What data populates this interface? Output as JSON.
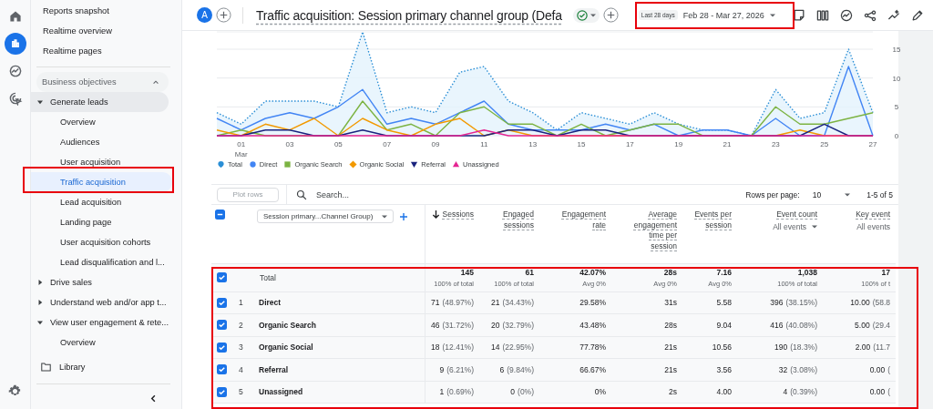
{
  "rail": {
    "items": [
      {
        "kind": "home",
        "selected": false
      },
      {
        "kind": "reports",
        "selected": true
      },
      {
        "kind": "explore",
        "selected": false
      },
      {
        "kind": "advertising",
        "selected": false
      }
    ]
  },
  "sidebar": {
    "items": [
      {
        "label": "Reports snapshot",
        "selected": false
      },
      {
        "label": "Realtime overview",
        "selected": false
      },
      {
        "label": "Realtime pages",
        "selected": false
      }
    ],
    "sections": [
      {
        "label": "Business objectives",
        "expanded": true,
        "children": [
          {
            "label": "Generate leads",
            "expanded": true,
            "children": [
              {
                "label": "Overview",
                "selected": false
              },
              {
                "label": "Audiences",
                "selected": false
              },
              {
                "label": "User acquisition",
                "selected": false
              },
              {
                "label": "Traffic acquisition",
                "selected": true
              },
              {
                "label": "Lead acquisition",
                "selected": false
              },
              {
                "label": "Landing page",
                "selected": false
              },
              {
                "label": "User acquisition cohorts",
                "selected": false
              },
              {
                "label": "Lead disqualification and l...",
                "selected": false
              }
            ]
          },
          {
            "label": "Drive sales",
            "expanded": false
          },
          {
            "label": "Understand web and/or app t...",
            "expanded": false
          },
          {
            "label": "View user engagement & rete...",
            "expanded": true,
            "children": [
              {
                "label": "Overview",
                "selected": false
              }
            ]
          }
        ]
      }
    ],
    "library": "Library"
  },
  "header": {
    "avatar": "A",
    "title": "Traffic acquisition: Session primary channel group (Defa",
    "date_chip": "Last 28 days",
    "date_range": "Feb 28 - Mar 27, 2026",
    "actions": [
      {
        "kind": "note"
      },
      {
        "kind": "compare"
      },
      {
        "kind": "insights"
      },
      {
        "kind": "share"
      },
      {
        "kind": "trend"
      },
      {
        "kind": "edit"
      }
    ]
  },
  "chart": {
    "chart_data": {
      "type": "line",
      "grid": true,
      "legend": "bottom",
      "xlim": [
        0,
        27
      ],
      "ylim": [
        0,
        18
      ],
      "x": [
        0,
        1,
        2,
        3,
        4,
        5,
        6,
        7,
        8,
        9,
        10,
        11,
        12,
        13,
        14,
        15,
        16,
        17,
        18,
        19,
        20,
        21,
        22,
        23,
        24,
        25,
        26,
        27
      ],
      "xticks": [
        {
          "value": 1,
          "label": "01"
        },
        {
          "value": 3,
          "label": "03"
        },
        {
          "value": 5,
          "label": "05"
        },
        {
          "value": 7,
          "label": "07"
        },
        {
          "value": 9,
          "label": "09"
        },
        {
          "value": 11,
          "label": "11"
        },
        {
          "value": 13,
          "label": "13"
        },
        {
          "value": 15,
          "label": "15"
        },
        {
          "value": 17,
          "label": "17"
        },
        {
          "value": 19,
          "label": "19"
        },
        {
          "value": 21,
          "label": "21"
        },
        {
          "value": 23,
          "label": "23"
        },
        {
          "value": 25,
          "label": "25"
        },
        {
          "value": 27,
          "label": "27"
        }
      ],
      "yticks": [
        0,
        5,
        10,
        15
      ],
      "annotations": [
        "Mar"
      ],
      "series": [
        {
          "name": "Total",
          "color": "#2b8fd6",
          "line_style": "dotted",
          "values": [
            4,
            2,
            6,
            6,
            6,
            5,
            18,
            4,
            5,
            4,
            11,
            12,
            6,
            4,
            1,
            4,
            3,
            2,
            4,
            2,
            1,
            1,
            0,
            8,
            3,
            4,
            15,
            4
          ]
        },
        {
          "name": "Direct",
          "color": "#4285f4",
          "line_style": "solid",
          "values": [
            3,
            1,
            3,
            4,
            3,
            5,
            8,
            2,
            3,
            2,
            4,
            6,
            2,
            1,
            1,
            1,
            2,
            1,
            2,
            0,
            1,
            1,
            0,
            3,
            0,
            0,
            12,
            0
          ]
        },
        {
          "name": "Organic Search",
          "color": "#7cb342",
          "line_style": "solid",
          "values": [
            0,
            1,
            0,
            0,
            0,
            0,
            6,
            1,
            2,
            0,
            4,
            5,
            2,
            2,
            0,
            2,
            0,
            1,
            2,
            2,
            0,
            0,
            0,
            5,
            2,
            2,
            3,
            4
          ]
        },
        {
          "name": "Organic Social",
          "color": "#f29900",
          "line_style": "solid",
          "values": [
            1,
            0,
            2,
            1,
            3,
            0,
            3,
            1,
            0,
            2,
            3,
            0,
            1,
            0,
            0,
            0,
            0,
            0,
            0,
            0,
            0,
            0,
            0,
            0,
            1,
            0,
            0,
            0
          ]
        },
        {
          "name": "Referral",
          "color": "#1a237e",
          "line_style": "solid",
          "values": [
            0,
            0,
            1,
            1,
            0,
            0,
            1,
            0,
            0,
            0,
            0,
            0,
            1,
            1,
            0,
            1,
            1,
            0,
            0,
            0,
            0,
            0,
            0,
            0,
            0,
            2,
            0,
            0
          ]
        },
        {
          "name": "Unassigned",
          "color": "#e52592",
          "line_style": "solid",
          "values": [
            0,
            0,
            0,
            0,
            0,
            0,
            0,
            0,
            0,
            0,
            0,
            1,
            0,
            0,
            0,
            0,
            0,
            0,
            0,
            0,
            0,
            0,
            0,
            0,
            0,
            0,
            0,
            0
          ]
        }
      ]
    }
  },
  "table": {
    "plot_rows": "Plot rows",
    "search_placeholder": "Search...",
    "rows_per_page_label": "Rows per page:",
    "rows_per_page": "10",
    "range": "1-5 of 5",
    "select_all": {
      "mixed": true
    },
    "dimension": "Session primary...Channel Group)",
    "columns": [
      {
        "label": "Sessions",
        "sorted": true
      },
      {
        "label": "Engaged sessions",
        "sorted": false
      },
      {
        "label": "Engagement rate",
        "sorted": false
      },
      {
        "label": "Average engagement time per session",
        "sorted": false
      },
      {
        "label": "Events per session",
        "sorted": false
      },
      {
        "label": "Event count",
        "sorted": false,
        "filter": "All events",
        "dropdown": true
      },
      {
        "label": "Key event",
        "sorted": false,
        "filter": "All events",
        "dropdown": false
      }
    ],
    "total": {
      "label": "Total",
      "checked": true,
      "cells": [
        {
          "value": "145",
          "note": "100% of total"
        },
        {
          "value": "61",
          "note": "100% of total"
        },
        {
          "value": "42.07%",
          "note": "Avg 0%"
        },
        {
          "value": "28s",
          "note": "Avg 0%"
        },
        {
          "value": "7.16",
          "note": "Avg 0%"
        },
        {
          "value": "1,038",
          "note": "100% of total"
        },
        {
          "value": "17",
          "note": "100% of t"
        }
      ]
    },
    "rows": [
      {
        "rank": "1",
        "channel": "Direct",
        "checked": true,
        "cells": [
          {
            "value": "71",
            "share": "(48.97%)"
          },
          {
            "value": "21",
            "share": "(34.43%)"
          },
          {
            "value": "29.58%"
          },
          {
            "value": "31s"
          },
          {
            "value": "5.58"
          },
          {
            "value": "396",
            "share": "(38.15%)"
          },
          {
            "value": "10.00",
            "share": "(58.8"
          }
        ]
      },
      {
        "rank": "2",
        "channel": "Organic Search",
        "checked": true,
        "cells": [
          {
            "value": "46",
            "share": "(31.72%)"
          },
          {
            "value": "20",
            "share": "(32.79%)"
          },
          {
            "value": "43.48%"
          },
          {
            "value": "28s"
          },
          {
            "value": "9.04"
          },
          {
            "value": "416",
            "share": "(40.08%)"
          },
          {
            "value": "5.00",
            "share": "(29.4"
          }
        ]
      },
      {
        "rank": "3",
        "channel": "Organic Social",
        "checked": true,
        "cells": [
          {
            "value": "18",
            "share": "(12.41%)"
          },
          {
            "value": "14",
            "share": "(22.95%)"
          },
          {
            "value": "77.78%"
          },
          {
            "value": "21s"
          },
          {
            "value": "10.56"
          },
          {
            "value": "190",
            "share": "(18.3%)"
          },
          {
            "value": "2.00",
            "share": "(11.7"
          }
        ]
      },
      {
        "rank": "4",
        "channel": "Referral",
        "checked": true,
        "cells": [
          {
            "value": "9",
            "share": "(6.21%)"
          },
          {
            "value": "6",
            "share": "(9.84%)"
          },
          {
            "value": "66.67%"
          },
          {
            "value": "21s"
          },
          {
            "value": "3.56"
          },
          {
            "value": "32",
            "share": "(3.08%)"
          },
          {
            "value": "0.00",
            "share": "("
          }
        ]
      },
      {
        "rank": "5",
        "channel": "Unassigned",
        "checked": true,
        "cells": [
          {
            "value": "1",
            "share": "(0.69%)"
          },
          {
            "value": "0",
            "share": "(0%)"
          },
          {
            "value": "0%"
          },
          {
            "value": "2s"
          },
          {
            "value": "4.00"
          },
          {
            "value": "4",
            "share": "(0.39%)"
          },
          {
            "value": "0.00",
            "share": "("
          }
        ]
      }
    ]
  }
}
